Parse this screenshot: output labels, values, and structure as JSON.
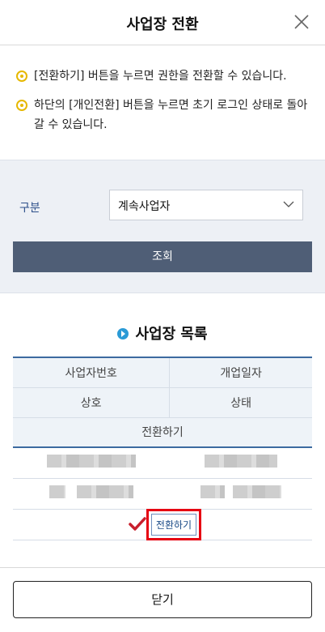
{
  "header": {
    "title": "사업장 전환",
    "close_icon": "close-icon"
  },
  "notice": {
    "items": [
      "[전환하기] 버튼을 누르면 권한을 전환할 수 있습니다.",
      "하단의 [개인전환] 버튼을 누르면 초기 로그인 상태로 돌아갈 수 있습니다."
    ],
    "bullet_icon": "circle-bullet-icon",
    "bullet_color": "#e6b800"
  },
  "filter": {
    "label": "구분",
    "select_value": "계속사업자",
    "search_label": "조회",
    "search_button_color": "#4f5e76",
    "background_color": "#edf0f5"
  },
  "list": {
    "title": "사업장 목록",
    "title_icon": "play-circle-icon",
    "columns": {
      "biz_no": "사업자번호",
      "open_date": "개업일자",
      "name": "상호",
      "status": "상태",
      "switch": "전환하기"
    },
    "row": {
      "switch_label": "전환하기",
      "check_icon": "checkmark-icon",
      "check_color": "#c8202e",
      "highlight_color": "#e60012"
    },
    "header_border_color": "#3c6aa0"
  },
  "footer": {
    "close_label": "닫기"
  }
}
